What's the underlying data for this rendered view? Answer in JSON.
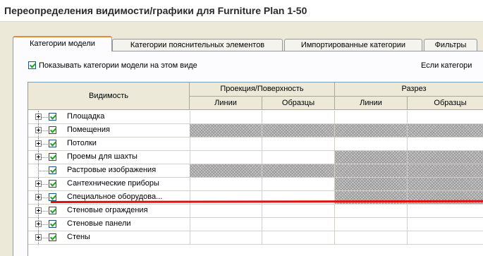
{
  "window": {
    "title": "Переопределения видимости/графики для Furniture Plan 1-50"
  },
  "tabs": [
    {
      "label": "Категории модели",
      "active": true
    },
    {
      "label": "Категории пояснительных элементов",
      "active": false
    },
    {
      "label": "Импортированные категории",
      "active": false
    },
    {
      "label": "Фильтры",
      "active": false
    }
  ],
  "show_checkbox": {
    "label": "Показывать категории модели на этом виде",
    "checked": true
  },
  "right_note": "Если категори",
  "grid": {
    "header": {
      "visibility": "Видимость",
      "projection": "Проекция/Поверхность",
      "section": "Разрез",
      "lines": "Линии",
      "patterns": "Образцы"
    },
    "rows": [
      {
        "label": "Площадка",
        "expandable": true,
        "checked": true,
        "hatch": [
          false,
          false,
          false,
          false
        ]
      },
      {
        "label": "Помещения",
        "expandable": true,
        "checked": true,
        "hatch": [
          true,
          true,
          true,
          true
        ]
      },
      {
        "label": "Потолки",
        "expandable": true,
        "checked": true,
        "hatch": [
          false,
          false,
          false,
          false
        ]
      },
      {
        "label": "Проемы для шахты",
        "expandable": true,
        "checked": true,
        "hatch": [
          false,
          false,
          true,
          true
        ]
      },
      {
        "label": "Растровые изображения",
        "expandable": false,
        "checked": true,
        "hatch": [
          true,
          true,
          true,
          true
        ]
      },
      {
        "label": "Сантехнические приборы",
        "expandable": true,
        "checked": true,
        "hatch": [
          false,
          false,
          true,
          true
        ]
      },
      {
        "label": "Специальное оборудова...",
        "expandable": true,
        "checked": true,
        "hatch": [
          false,
          false,
          true,
          true
        ]
      },
      {
        "label": "Стеновые ограждения",
        "expandable": true,
        "checked": true,
        "hatch": [
          false,
          false,
          false,
          false
        ]
      },
      {
        "label": "Стеновые панели",
        "expandable": true,
        "checked": true,
        "hatch": [
          false,
          false,
          false,
          false
        ]
      },
      {
        "label": "Стены",
        "expandable": true,
        "checked": true,
        "hatch": [
          false,
          false,
          false,
          false
        ]
      }
    ]
  },
  "colors": {
    "annotation_line": "#e11010",
    "tab_accent": "#e68b2c",
    "checkmark": "#21a121"
  }
}
